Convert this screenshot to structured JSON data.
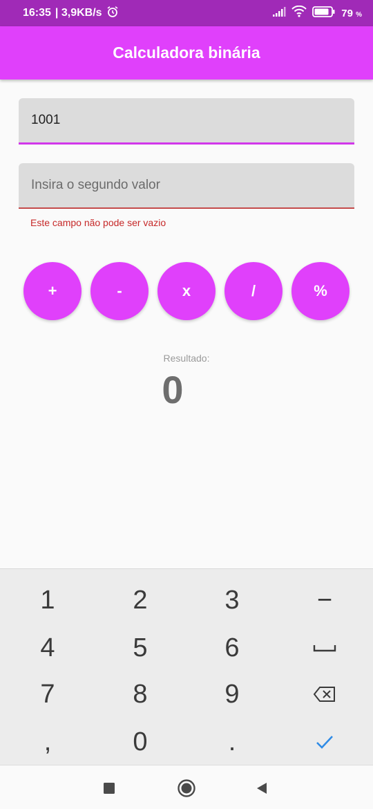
{
  "status_bar": {
    "time": "16:35",
    "speed": "| 3,9KB/s",
    "battery_pct": "79",
    "battery_unit": "%",
    "icons": [
      "alarm-icon",
      "signal-icon",
      "wifi-icon",
      "battery-icon"
    ]
  },
  "app_bar": {
    "title": "Calculadora binária",
    "color": "#e040fb"
  },
  "form": {
    "first_value": "1001",
    "second_placeholder": "Insira o segundo valor",
    "second_error": "Este campo não pode ser vazio"
  },
  "operations": [
    "+",
    "-",
    "x",
    "/",
    "%"
  ],
  "result": {
    "label": "Resultado:",
    "value": "0"
  },
  "keyboard": {
    "keys": [
      "1",
      "2",
      "3",
      "−",
      "4",
      "5",
      "6",
      "space",
      "7",
      "8",
      "9",
      "backspace",
      ",",
      "0",
      ".",
      "done"
    ]
  },
  "nav_bar": {
    "buttons": [
      "recents-button",
      "home-button",
      "back-button"
    ]
  }
}
